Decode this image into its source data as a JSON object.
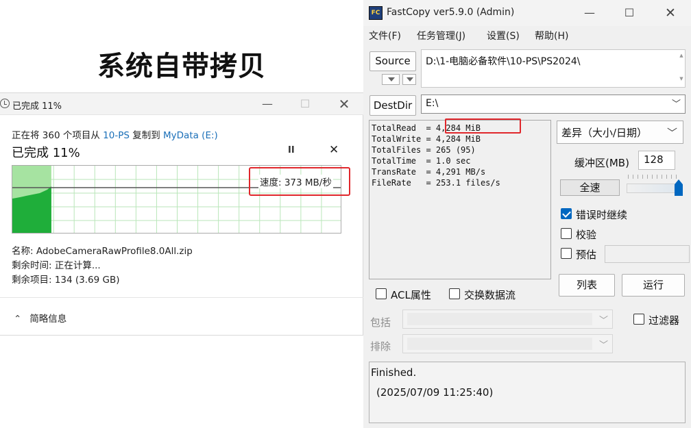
{
  "heading": "系统自带拷贝",
  "win_dialog": {
    "title": "已完成 11%",
    "desc_prefix": "正在将 360 个项目从 ",
    "source_link": "10-PS",
    "desc_middle": " 复制到 ",
    "dest_link": "MyData (E:)",
    "progress_title": "已完成 11%",
    "pause_icon": "pause-icon",
    "speed_label": "速度: 373 MB/秒",
    "progress_fraction": 0.11,
    "name_line": "名称: AdobeCameraRawProfile8.0All.zip",
    "time_line": "剩余时间: 正在计算...",
    "items_line": "剩余项目: 134 (3.69 GB)",
    "details_toggle": "简略信息",
    "colors": {
      "graph_fill": "#1fae3a",
      "graph_done": "#a6e3a1",
      "highlight": "#e0262b",
      "link": "#1a6fb8"
    }
  },
  "fastcopy": {
    "icon_text": "FC",
    "title": "FastCopy ver5.9.0 (Admin)",
    "menu": [
      "文件(F)",
      "任务管理(J)",
      "设置(S)",
      "帮助(H)"
    ],
    "source_button": "Source",
    "source_path": "D:\\1-电脑必备软件\\10-PS\\PS2024\\",
    "destdir_button": "DestDir",
    "dest_path": "E:\\",
    "stats": [
      "TotalRead  = 4,284 MiB",
      "TotalWrite = 4,284 MiB",
      "TotalFiles = 265 (95)",
      "TotalTime  = 1.0 sec",
      "TransRate  = 4,291 MB/s",
      "FileRate   = 253.1 files/s"
    ],
    "mode": "差异（大小/日期）",
    "buffer_label": "缓冲区(MB)",
    "buffer_value": "128",
    "speed_button": "全速",
    "speed_level": 1.0,
    "checkboxes": {
      "continue_on_error": "错误时继续",
      "verify": "校验",
      "estimate": "预估",
      "acl": "ACL属性",
      "streams": "交换数据流",
      "filter": "过滤器"
    },
    "list_button": "列表",
    "run_button": "运行",
    "include_label": "包括",
    "exclude_label": "排除",
    "status_line1": "Finished.",
    "status_line2": "(2025/07/09 11:25:40)",
    "colors": {
      "accent": "#0067c0",
      "highlight": "#e0262b"
    }
  }
}
